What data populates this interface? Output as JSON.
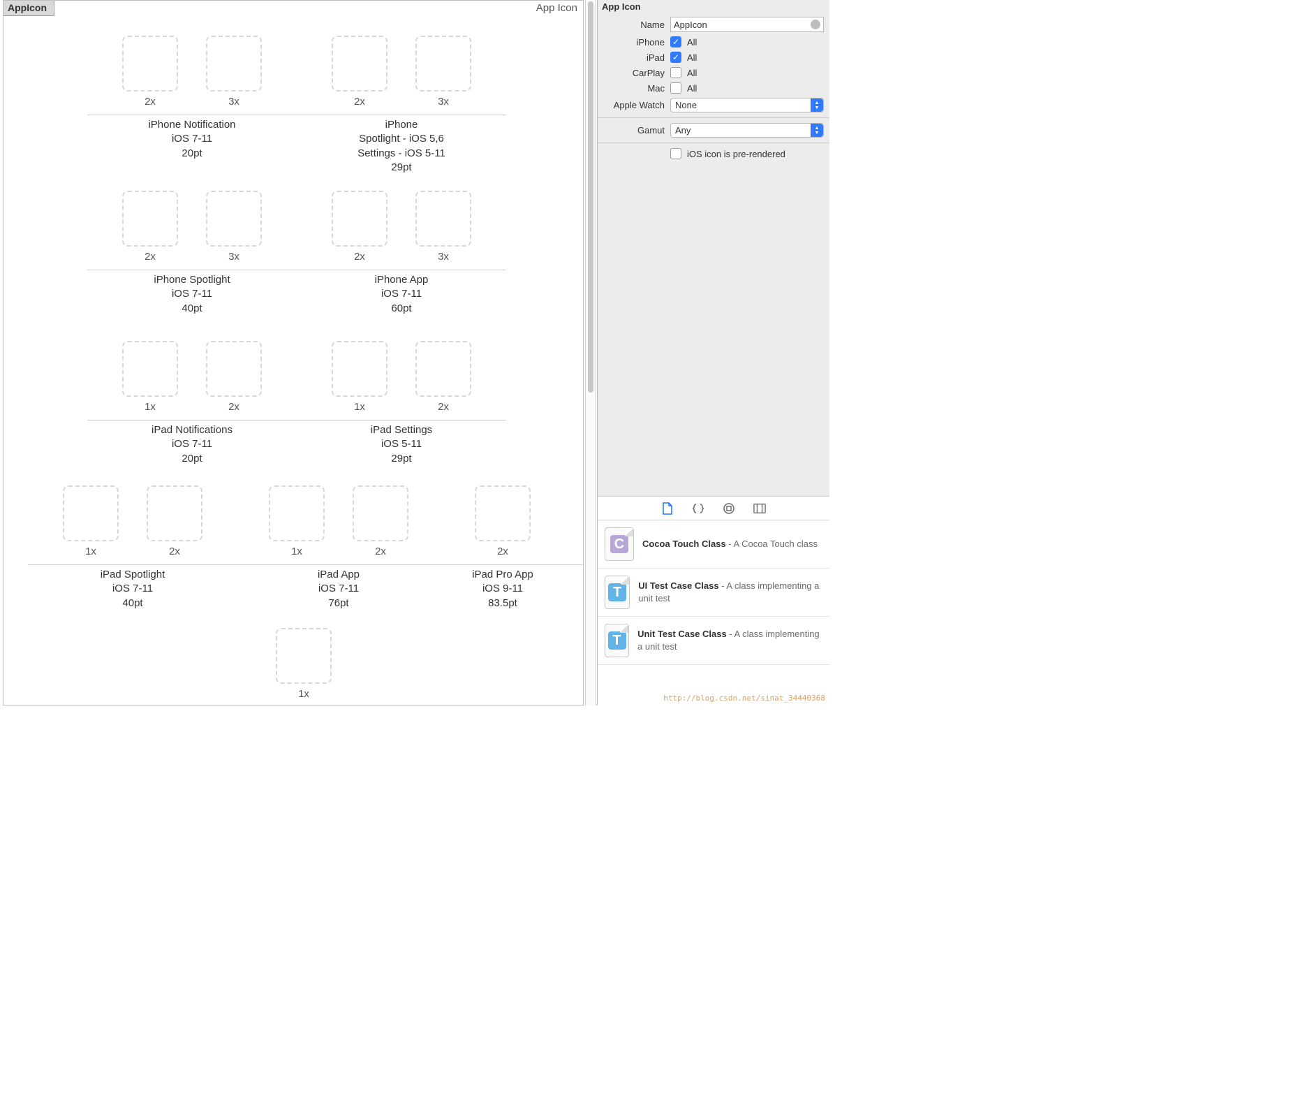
{
  "editor": {
    "chip": "AppIcon",
    "header_right": "App Icon",
    "groups": [
      {
        "id": "g1",
        "scales": [
          "2x",
          "3x"
        ],
        "lines": [
          "iPhone Notification",
          "iOS 7-11",
          "20pt"
        ]
      },
      {
        "id": "g2",
        "scales": [
          "2x",
          "3x"
        ],
        "lines": [
          "iPhone",
          "Spotlight - iOS 5,6",
          "Settings - iOS 5-11",
          "29pt"
        ]
      },
      {
        "id": "g3",
        "scales": [
          "2x",
          "3x"
        ],
        "lines": [
          "iPhone Spotlight",
          "iOS 7-11",
          "40pt"
        ]
      },
      {
        "id": "g4",
        "scales": [
          "2x",
          "3x"
        ],
        "lines": [
          "iPhone App",
          "iOS 7-11",
          "60pt"
        ]
      },
      {
        "id": "g5",
        "scales": [
          "1x",
          "2x"
        ],
        "lines": [
          "iPad Notifications",
          "iOS 7-11",
          "20pt"
        ]
      },
      {
        "id": "g6",
        "scales": [
          "1x",
          "2x"
        ],
        "lines": [
          "iPad Settings",
          "iOS 5-11",
          "29pt"
        ]
      },
      {
        "id": "g7",
        "scales": [
          "1x",
          "2x"
        ],
        "lines": [
          "iPad Spotlight",
          "iOS 7-11",
          "40pt"
        ]
      },
      {
        "id": "g8",
        "scales": [
          "1x",
          "2x"
        ],
        "lines": [
          "iPad App",
          "iOS 7-11",
          "76pt"
        ]
      },
      {
        "id": "g9",
        "scales": [
          "2x"
        ],
        "lines": [
          "iPad Pro App",
          "iOS 9-11",
          "83.5pt"
        ]
      },
      {
        "id": "g10",
        "scales": [
          "1x"
        ],
        "lines": []
      }
    ]
  },
  "inspector": {
    "title": "App Icon",
    "name_label": "Name",
    "name_value": "AppIcon",
    "rows": [
      {
        "label": "iPhone",
        "checked": true,
        "value": "All"
      },
      {
        "label": "iPad",
        "checked": true,
        "value": "All"
      },
      {
        "label": "CarPlay",
        "checked": false,
        "value": "All"
      },
      {
        "label": "Mac",
        "checked": false,
        "value": "All"
      }
    ],
    "applewatch_label": "Apple Watch",
    "applewatch_value": "None",
    "gamut_label": "Gamut",
    "gamut_value": "Any",
    "prerendered_label": "iOS icon is pre-rendered"
  },
  "library": {
    "items": [
      {
        "glyph": "C",
        "cls": "c",
        "title": "Cocoa Touch Class",
        "desc": " - A Cocoa Touch class"
      },
      {
        "glyph": "T",
        "cls": "t",
        "title": "UI Test Case Class",
        "desc": " - A class implementing a unit test"
      },
      {
        "glyph": "T",
        "cls": "t",
        "title": "Unit Test Case Class",
        "desc": " - A class implementing a unit test"
      }
    ]
  },
  "watermark": "http://blog.csdn.net/sinat_34440368"
}
